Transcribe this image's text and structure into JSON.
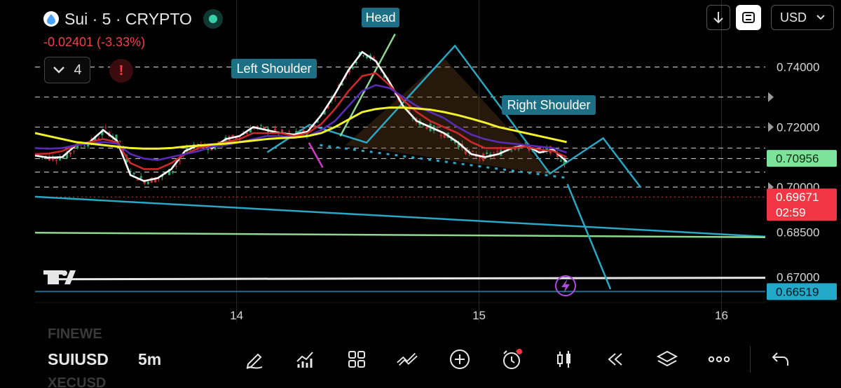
{
  "header": {
    "symbol_title": "Sui · 5 · CRYPTO",
    "change": "-0.02401 (-3.33%)",
    "indicator_count": "4",
    "alert_glyph": "!",
    "currency": "USD"
  },
  "chart_data": {
    "type": "line",
    "title": "Sui · 5 · CRYPTO",
    "price_axis": {
      "ticks": [
        "0.74000",
        "0.72000",
        "0.70000",
        "0.68500",
        "0.67000"
      ],
      "ylim": [
        0.662,
        0.753
      ]
    },
    "time_axis": {
      "ticks": [
        "14",
        "15",
        "16"
      ]
    },
    "price_labels": [
      {
        "value": "0.70956",
        "bg": "#7ee39a",
        "fg": "#0b2a12"
      },
      {
        "value": "0.69671",
        "extra": "02:59",
        "bg": "#f23645",
        "fg": "#ffffff"
      },
      {
        "value": "0.66519",
        "bg": "#22a8c8",
        "fg": "#041a22"
      }
    ],
    "last_price": 0.69671,
    "annotations": [
      "Left Shoulder",
      "Head",
      "Right Shoulder"
    ],
    "pattern_points": [
      {
        "x": 0.318,
        "y": 0.7116
      },
      {
        "x": 0.376,
        "y": 0.7208
      },
      {
        "x": 0.454,
        "y": 0.7148
      },
      {
        "x": 0.575,
        "y": 0.7471
      },
      {
        "x": 0.705,
        "y": 0.7045
      },
      {
        "x": 0.778,
        "y": 0.7163
      },
      {
        "x": 0.829,
        "y": 0.7
      }
    ],
    "series": [
      {
        "name": "",
        "color": "#ffffff",
        "values": [
          0.7105,
          0.7098,
          0.71,
          0.714,
          0.715,
          0.719,
          0.7155,
          0.704,
          0.702,
          0.703,
          0.706,
          0.712,
          0.714,
          0.713,
          0.716,
          0.717,
          0.72,
          0.719,
          0.718,
          0.7175,
          0.7185,
          0.724,
          0.731,
          0.739,
          0.745,
          0.742,
          0.735,
          0.727,
          0.722,
          0.72,
          0.718,
          0.715,
          0.711,
          0.71,
          0.711,
          0.713,
          0.714,
          0.7115,
          0.7125,
          0.7085
        ]
      },
      {
        "name": "",
        "color": "#cc2a2a",
        "values": [
          0.711,
          0.7112,
          0.712,
          0.714,
          0.715,
          0.716,
          0.715,
          0.708,
          0.706,
          0.706,
          0.708,
          0.711,
          0.713,
          0.714,
          0.715,
          0.716,
          0.718,
          0.718,
          0.718,
          0.717,
          0.718,
          0.721,
          0.726,
          0.732,
          0.737,
          0.738,
          0.734,
          0.729,
          0.725,
          0.722,
          0.72,
          0.718,
          0.715,
          0.713,
          0.713,
          0.713,
          0.7135,
          0.7125,
          0.712,
          0.71
        ]
      },
      {
        "name": "",
        "color": "#5a2bb5",
        "values": [
          0.713,
          0.7128,
          0.713,
          0.714,
          0.7145,
          0.715,
          0.7145,
          0.711,
          0.7095,
          0.709,
          0.71,
          0.711,
          0.712,
          0.7135,
          0.714,
          0.715,
          0.716,
          0.717,
          0.717,
          0.7165,
          0.717,
          0.719,
          0.722,
          0.727,
          0.732,
          0.734,
          0.733,
          0.73,
          0.727,
          0.725,
          0.723,
          0.72,
          0.7175,
          0.716,
          0.715,
          0.7145,
          0.714,
          0.7135,
          0.713,
          0.7115
        ]
      },
      {
        "name": "",
        "color": "#f2f22a",
        "values": [
          0.718,
          0.717,
          0.716,
          0.715,
          0.7145,
          0.714,
          0.7135,
          0.713,
          0.7128,
          0.7128,
          0.713,
          0.7135,
          0.7138,
          0.7142,
          0.7145,
          0.715,
          0.7155,
          0.716,
          0.7163,
          0.7165,
          0.717,
          0.718,
          0.72,
          0.7225,
          0.725,
          0.726,
          0.7265,
          0.7265,
          0.7262,
          0.7258,
          0.725,
          0.724,
          0.7228,
          0.7215,
          0.72,
          0.719,
          0.718,
          0.717,
          0.716,
          0.715
        ]
      }
    ]
  },
  "toolbar": {
    "ticker": "SUIUSD",
    "timeframe": "5m",
    "ghost_above": "FINEWE",
    "ghost_below": "XECUSD"
  }
}
